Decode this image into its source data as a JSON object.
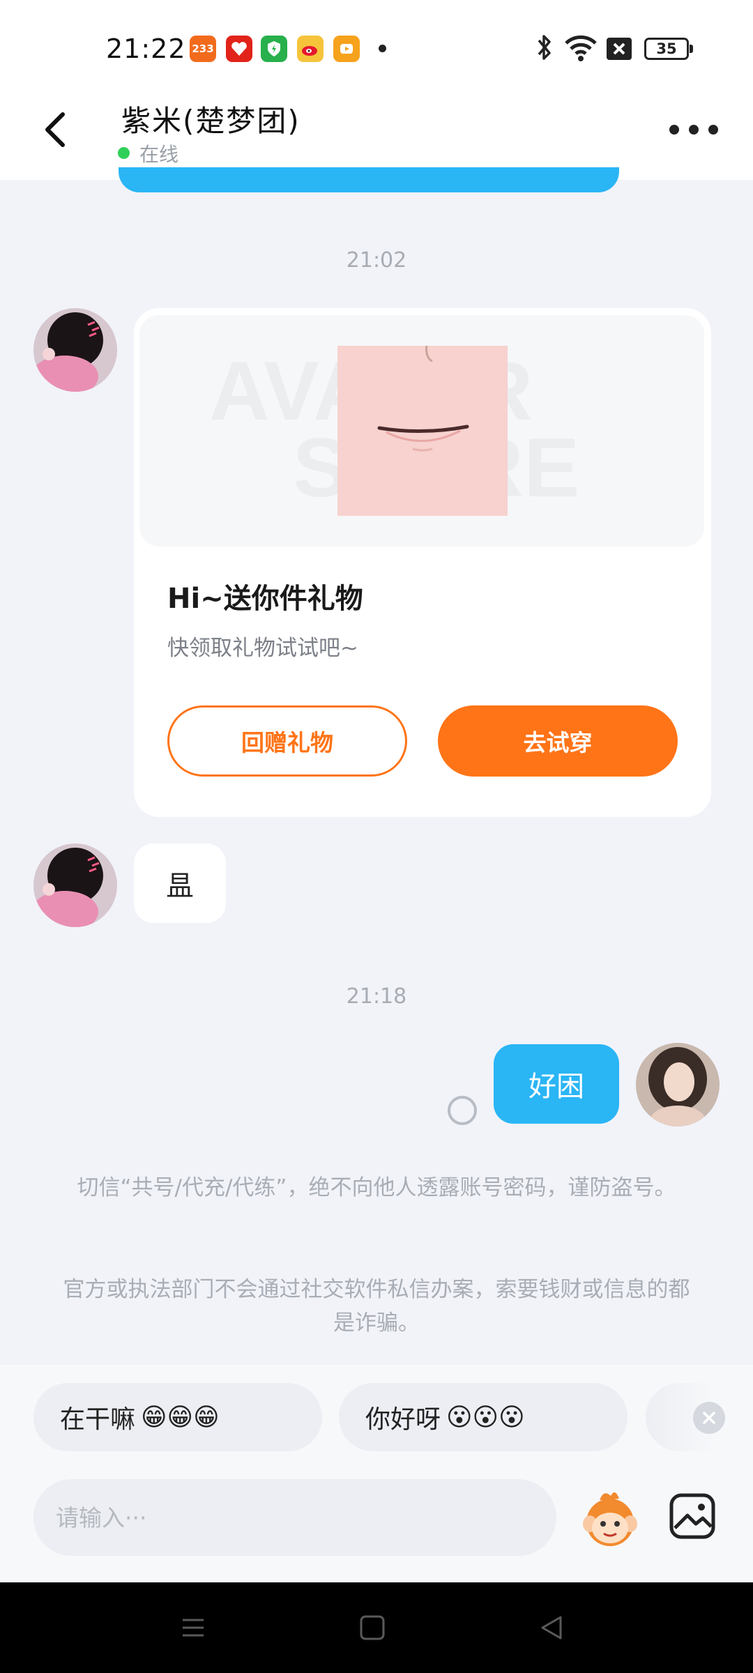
{
  "status_bar": {
    "time": "21:22",
    "battery": "35",
    "app_icons": [
      {
        "name": "app-233-icon",
        "label": "233",
        "color": "#f26b1d"
      },
      {
        "name": "app-heart-icon",
        "label": "",
        "color": "#e2231a"
      },
      {
        "name": "app-shield-icon",
        "label": "",
        "color": "#27b04b"
      },
      {
        "name": "weibo-icon",
        "label": "",
        "color": "#f5c43b"
      },
      {
        "name": "app-video-icon",
        "label": "",
        "color": "#f7a21c"
      }
    ]
  },
  "header": {
    "title": "紫米(楚梦团)",
    "status": "在线"
  },
  "messages": {
    "time_1": "21:02",
    "gift_card": {
      "title": "Hi~送你件礼物",
      "subtitle": "快领取礼物试试吧~",
      "watermark_1": "AVATAR",
      "watermark_2": "STORE",
      "button_return": "回赠礼物",
      "button_try": "去试穿"
    },
    "incoming_text": "昷",
    "time_2": "21:18",
    "outgoing_text": "好困"
  },
  "notice": {
    "line_1": "切信“共号/代充/代练”，绝不向他人透露账号密码，谨防盗号。",
    "line_2": "官方或执法部门不会通过社交软件私信办案，索要钱财或信息的都是诈骗。"
  },
  "quick_replies": [
    {
      "text": "在干嘛",
      "emoji": "😁😁😁"
    },
    {
      "text": "你好呀",
      "emoji": "😮😮😮"
    }
  ],
  "input": {
    "placeholder": "请输入···"
  },
  "colors": {
    "accent_orange": "#ff7417",
    "bubble_blue": "#2ab5f5",
    "online_green": "#2fd05a"
  }
}
